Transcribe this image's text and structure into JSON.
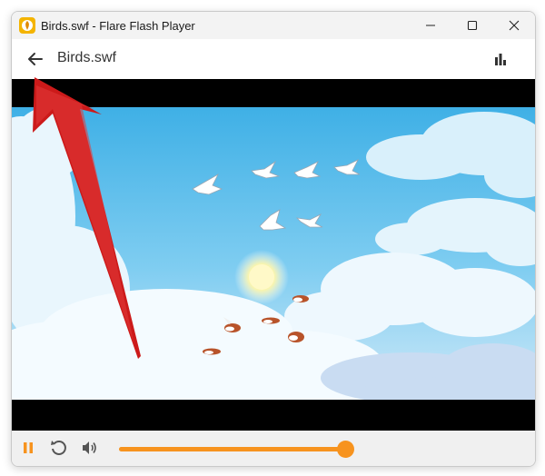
{
  "window": {
    "title": "Birds.swf - Flare Flash Player",
    "app_icon": "flare-app-icon",
    "minimize_icon": "minimize-icon",
    "maximize_icon": "maximize-icon",
    "close_icon": "close-icon"
  },
  "toolbar": {
    "back_icon": "arrow-left-icon",
    "file_name": "Birds.swf",
    "stats_icon": "bar-chart-icon"
  },
  "player": {
    "content": "flash-animation-birds-in-sky",
    "state": "playing"
  },
  "controls": {
    "pause_icon": "pause-icon",
    "restart_icon": "restart-icon",
    "volume_icon": "volume-icon",
    "volume_level": 1.0
  },
  "colors": {
    "accent": "#f7931e",
    "annotation_arrow": "#cc1a1a",
    "sky_top": "#3fb0e6",
    "sky_bottom": "#cfe9f8"
  }
}
